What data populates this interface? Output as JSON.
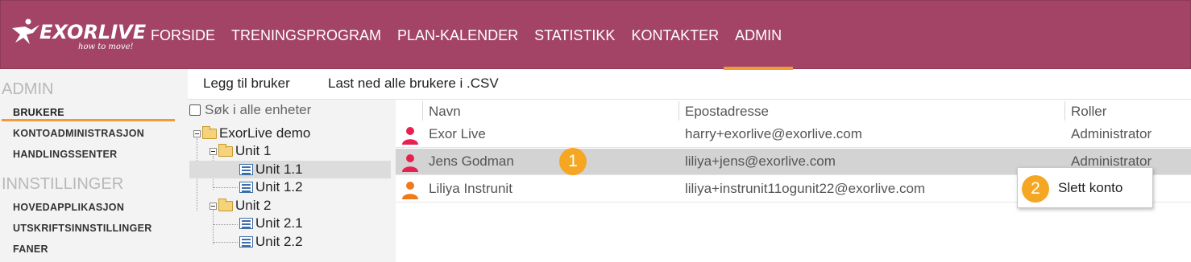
{
  "brand": {
    "name": "EXORLIVE",
    "tagline": "how to move!"
  },
  "nav": {
    "items": [
      {
        "label": "FORSIDE"
      },
      {
        "label": "TRENINGSPROGRAM"
      },
      {
        "label": "PLAN-KALENDER"
      },
      {
        "label": "STATISTIKK"
      },
      {
        "label": "KONTAKTER"
      },
      {
        "label": "ADMIN",
        "active": true
      }
    ]
  },
  "sidebar": {
    "section1": "ADMIN",
    "items1": [
      "BRUKERE",
      "KONTOADMINISTRASJON",
      "HANDLINGSSENTER"
    ],
    "section2": "INNSTILLINGER",
    "items2": [
      "HOVEDAPPLIKASJON",
      "UTSKRIFTSINNSTILLINGER",
      "FANER"
    ]
  },
  "toolbar": {
    "add_user": "Legg til bruker",
    "download_csv": "Last ned alle brukere i .CSV"
  },
  "tree": {
    "search_label": "Søk i alle enheter",
    "root": "ExorLive demo",
    "units": [
      "Unit 1",
      "Unit 1.1",
      "Unit 1.2",
      "Unit 2",
      "Unit 2.1",
      "Unit 2.2"
    ],
    "selected": "Unit 1.1"
  },
  "grid": {
    "columns": [
      "Navn",
      "Epostadresse",
      "Roller"
    ],
    "rows": [
      {
        "name": "Exor Live",
        "email": "harry+exorlive@exorlive.com",
        "role": "Administrator",
        "icon_color": "#e8204f"
      },
      {
        "name": "Jens Godman",
        "email": "liliya+jens@exorlive.com",
        "role": "Administrator",
        "icon_color": "#e8204f",
        "selected": true
      },
      {
        "name": "Liliya Instrunit",
        "email": "liliya+instrunit11ogunit22@exorlive.com",
        "role": "",
        "icon_color": "#f07a1a"
      }
    ]
  },
  "context_menu": {
    "items": [
      "Slett konto"
    ]
  },
  "badges": [
    "1",
    "2"
  ],
  "colors": {
    "header": "#a34467",
    "accent": "#f29a38",
    "badge": "#f5a623"
  }
}
